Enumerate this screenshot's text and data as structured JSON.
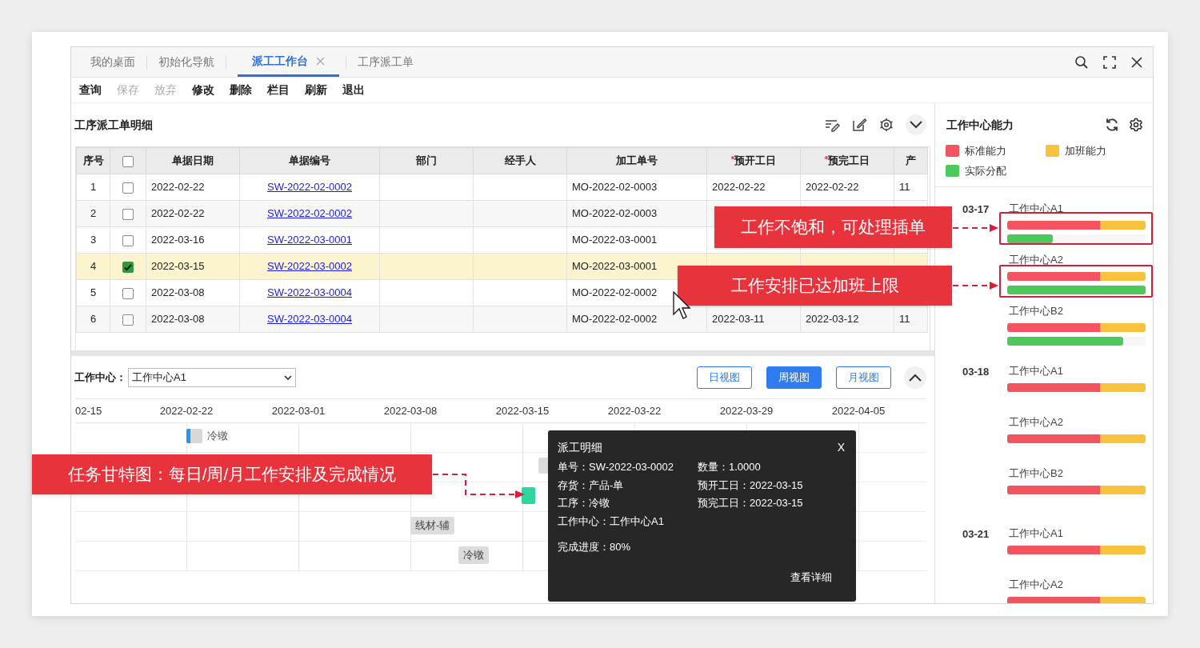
{
  "tabs": [
    {
      "label": "我的桌面",
      "selected": false
    },
    {
      "label": "初始化导航",
      "selected": false
    },
    {
      "label": "派工工作台",
      "selected": true
    },
    {
      "label": "工序派工单",
      "selected": false
    }
  ],
  "toolbar": [
    {
      "label": "查询",
      "disabled": false
    },
    {
      "label": "保存",
      "disabled": true
    },
    {
      "label": "放弃",
      "disabled": true
    },
    {
      "label": "修改",
      "disabled": false
    },
    {
      "label": "删除",
      "disabled": false
    },
    {
      "label": "栏目",
      "disabled": false
    },
    {
      "label": "刷新",
      "disabled": false
    },
    {
      "label": "退出",
      "disabled": false
    }
  ],
  "detail_table": {
    "title": "工序派工单明细",
    "columns": [
      {
        "kind": "text",
        "label": "序号"
      },
      {
        "kind": "checkbox",
        "checked": false
      },
      {
        "kind": "text",
        "label": "单据日期"
      },
      {
        "kind": "text",
        "label": "单据编号"
      },
      {
        "kind": "text",
        "label": "部门"
      },
      {
        "kind": "text",
        "label": "经手人"
      },
      {
        "kind": "text",
        "label": "加工单号"
      },
      {
        "kind": "text",
        "label": "预开工日",
        "required_mark": "*"
      },
      {
        "kind": "text",
        "label": "预完工日",
        "required_mark": "*"
      },
      {
        "kind": "text",
        "label": "产"
      }
    ],
    "rows": [
      {
        "no": "1",
        "checked": false,
        "selected": false,
        "date": "2022-02-22",
        "bill_no": "SW-2022-02-0002",
        "mo_no": "MO-2022-02-0003",
        "planned_start": "2022-02-22",
        "planned_end": "2022-02-22",
        "column_10": "11"
      },
      {
        "no": "2",
        "checked": false,
        "selected": false,
        "date": "2022-02-22",
        "bill_no": "SW-2022-02-0002",
        "mo_no": "MO-2022-02-0003"
      },
      {
        "no": "3",
        "checked": false,
        "selected": false,
        "date": "2022-03-16",
        "bill_no": "SW-2022-03-0001",
        "mo_no": "MO-2022-03-0001"
      },
      {
        "no": "4",
        "checked": true,
        "selected": true,
        "date": "2022-03-15",
        "bill_no": "SW-2022-03-0002",
        "mo_no": "MO-2022-03-0001"
      },
      {
        "no": "5",
        "checked": false,
        "selected": false,
        "date": "2022-03-08",
        "bill_no": "SW-2022-03-0004",
        "mo_no": "MO-2022-02-0002"
      },
      {
        "no": "6",
        "checked": false,
        "selected": false,
        "date": "2022-03-08",
        "bill_no": "SW-2022-03-0004",
        "mo_no": "MO-2022-02-0002",
        "planned_start": "2022-03-11",
        "planned_end": "2022-03-12",
        "column_10": "11"
      }
    ]
  },
  "gantt": {
    "filter_label": "工作中心：",
    "filter_value": "工作中心A1",
    "views": [
      {
        "label": "日视图",
        "selected": false
      },
      {
        "label": "周视图",
        "selected": true
      },
      {
        "label": "月视图",
        "selected": false
      }
    ],
    "axis": [
      "02-15",
      "2022-02-22",
      "2022-03-01",
      "2022-03-08",
      "2022-03-15",
      "2022-03-22",
      "2022-03-29",
      "2022-04-05"
    ],
    "tasks": [
      {
        "kind": "started",
        "label": "冷镦"
      },
      {
        "kind": "pending"
      },
      {
        "kind": "done"
      },
      {
        "kind": "pending",
        "label": "线材-辅"
      },
      {
        "kind": "pending",
        "label": "冷镦"
      }
    ],
    "popup": {
      "title": "派工明细",
      "close": "X",
      "fields": [
        {
          "label": "单号：",
          "value": "SW-2022-03-0002"
        },
        {
          "label": "数量：",
          "value": "1.0000"
        },
        {
          "label": "存货：",
          "value": "产品-单"
        },
        {
          "label": "预开工日：",
          "value": "2022-03-15"
        },
        {
          "label": "工序：",
          "value": "冷镦"
        },
        {
          "label": "预完工日：",
          "value": "2022-03-15"
        },
        {
          "label": "工作中心：",
          "value": "工作中心A1"
        }
      ],
      "progress": {
        "label": "完成进度：",
        "value": "80%"
      },
      "link": "查看详细"
    }
  },
  "capacity": {
    "title": "工作中心能力",
    "legend": [
      {
        "label": "标准能力",
        "color": "#f25560"
      },
      {
        "label": "加班能力",
        "color": "#f9c23c"
      },
      {
        "label": "实际分配",
        "color": "#4cc95a"
      }
    ],
    "days": [
      {
        "date": "03-17",
        "centers": [
          {
            "name": "工作中心A1",
            "level": 0.33
          },
          {
            "name": "工作中心A2",
            "level": 1.0
          },
          {
            "name": "工作中心B2",
            "level": 0.84
          }
        ]
      },
      {
        "date": "03-18",
        "centers": [
          {
            "name": "工作中心A1"
          },
          {
            "name": "工作中心A2"
          },
          {
            "name": "工作中心B2"
          }
        ]
      },
      {
        "date": "03-21",
        "centers": [
          {
            "name": "工作中心A1"
          },
          {
            "name": "工作中心A2"
          }
        ]
      }
    ]
  },
  "annotations": [
    "工作不饱和，可处理插单",
    "工作安排已达加班上限",
    "任务甘特图：每日/周/月工作安排及完成情况"
  ]
}
